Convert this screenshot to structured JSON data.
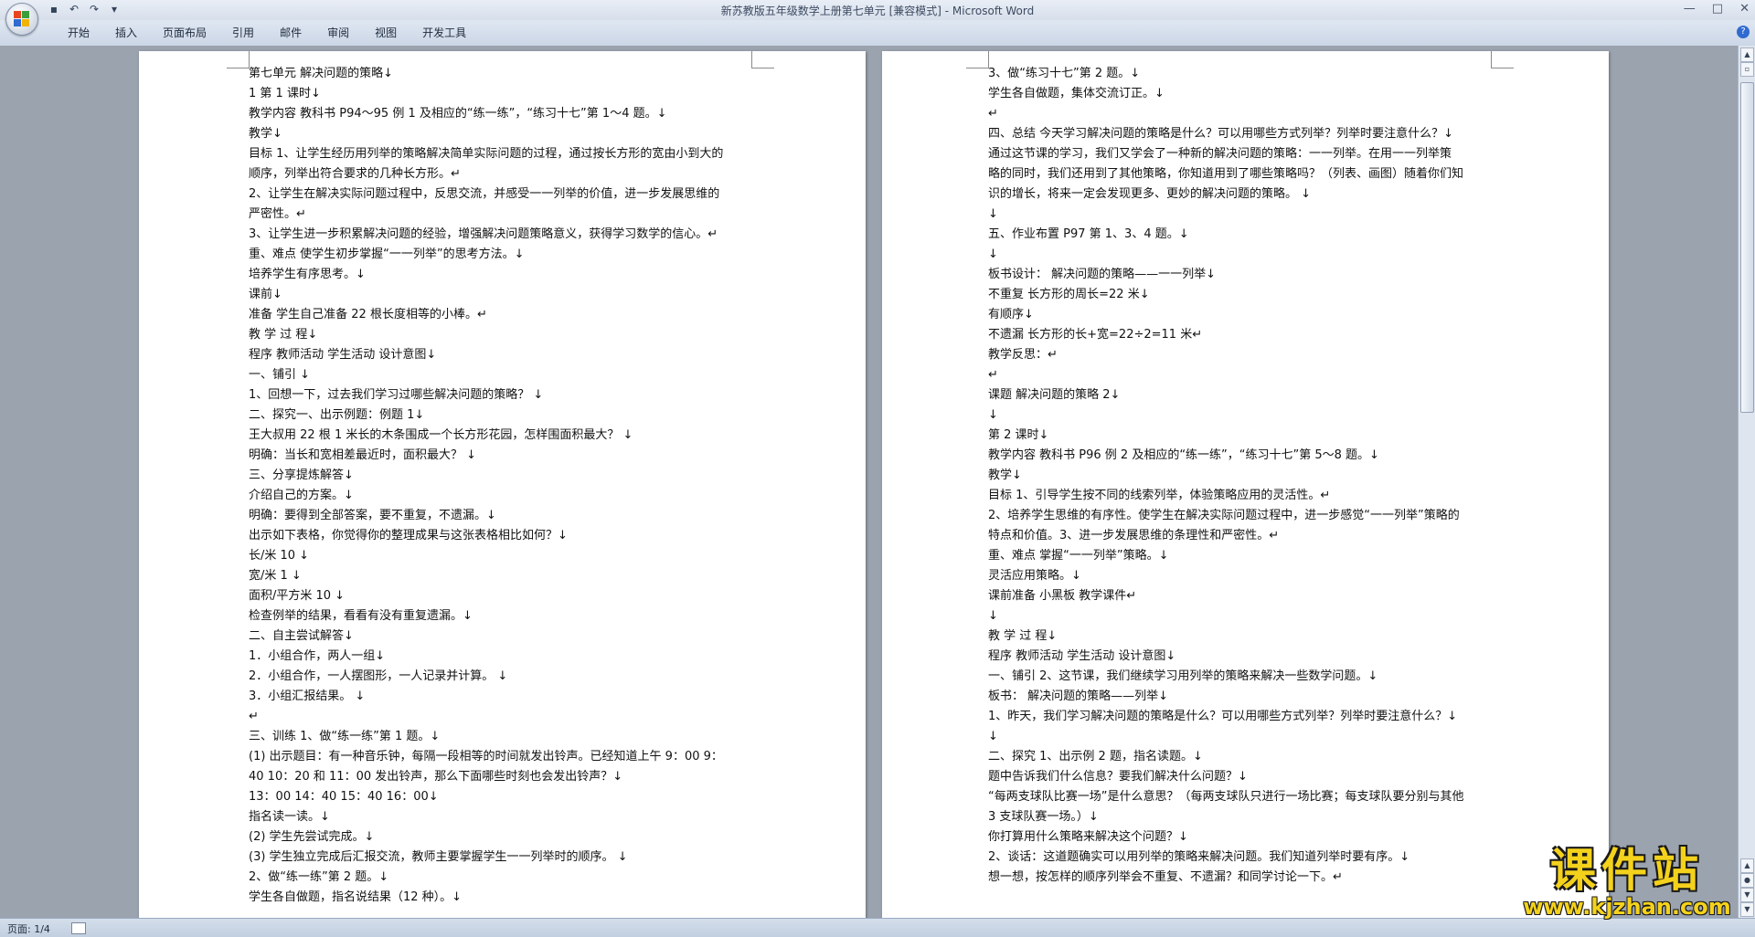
{
  "window": {
    "title": "新苏教版五年级数学上册第七单元 [兼容模式] - Microsoft Word",
    "controls": [
      "—",
      "□",
      "✕"
    ]
  },
  "ribbon": {
    "tabs": [
      "开始",
      "插入",
      "页面布局",
      "引用",
      "邮件",
      "审阅",
      "视图",
      "开发工具"
    ],
    "help": "?"
  },
  "document": {
    "left_page": [
      " 第七单元    解决问题的策略↓",
      " 1 第 1 课时↓",
      " 教学内容 教科书 P94～95 例 1 及相应的“练一练”，“练习十七”第 1～4 题。↓",
      " 教学↓",
      " 目标 1、让学生经历用列举的策略解决简单实际问题的过程，通过按长方形的宽由小到大的",
      " 顺序，列举出符合要求的几种长方形。↵",
      "  2、让学生在解决实际问题过程中，反思交流，并感受一一列举的价值，进一步发展思维的",
      " 严密性。↵",
      " 3、让学生进一步积累解决问题的经验，增强解决问题策略意义，获得学习数学的信心。↵",
      " 重、难点 使学生初步掌握“一一列举”的思考方法。↓",
      "  培养学生有序思考。↓",
      " 课前↓",
      " 准备 学生自己准备 22 根长度相等的小棒。↵",
      "  教           学           过           程↓",
      " 程序 教师活动 学生活动 设计意图↓",
      " 一、铺引 ↓",
      "  1、回想一下，过去我们学习过哪些解决问题的策略？ ↓",
      " 二、探究一、出示例题：例题 1↓",
      " 王大叔用 22 根 1 米长的木条围成一个长方形花园，怎样围面积最大？ ↓",
      " 明确：当长和宽相差最近时，面积最大？ ↓",
      " 三、分享提炼解答↓",
      " 介绍自己的方案。↓",
      " 明确：要得到全部答案，要不重复，不遗漏。↓",
      "  出示如下表格，你觉得你的整理成果与这张表格相比如何？↓",
      " 长/米 10    ↓",
      " 宽/米 1    ↓",
      " 面积/平方米 10    ↓",
      " 检查例举的结果，看看有没有重复遗漏。↓",
      " 二、自主尝试解答↓",
      " 1．小组合作，两人一组↓",
      " 2．小组合作，一人摆图形，一人记录并计算。 ↓",
      " 3．小组汇报结果。 ↓",
      " ↵",
      " 三、训练 1、做“练一练”第 1 题。↓",
      "  (1) 出示题目：有一种音乐钟，每隔一段相等的时间就发出铃声。已经知道上午 9：00   9：",
      " 40   10：20 和 11：00 发出铃声，那么下面哪些时刻也会发出铃声？↓",
      " 13：00     14：40     15：40     16：00↓",
      "  指名读一读。↓",
      "  (2) 学生先尝试完成。↓",
      "  (3) 学生独立完成后汇报交流，教师主要掌握学生一一列举时的顺序。 ↓",
      " 2、做“练一练”第 2 题。↓",
      " 学生各自做题，指名说结果（12 种）。↓"
    ],
    "right_page": [
      " 3、做“练习十七”第 2 题。↓",
      " 学生各自做题，集体交流订正。↓",
      " ↵",
      " 四、总结 今天学习解决问题的策略是什么？可以用哪些方式列举？列举时要注意什么？↓",
      "  通过这节课的学习，我们又学会了一种新的解决问题的策略：一一列举。在用一一列举策",
      " 略的同时，我们还用到了其他策略，你知道用到了哪些策略吗？（列表、画图）随着你们知",
      " 识的增长，将来一定会发现更多、更妙的解决问题的策略。 ↓",
      "  ↓",
      " 五、作业布置  P97 第 1、3、4 题。↓",
      "  ↓",
      " 板书设计：              解决问题的策略——一一列举↓",
      " 不重复      长方形的周长=22 米↓",
      " 有顺序↓",
      " 不遗漏      长方形的长+宽=22÷2=11 米↵",
      " 教学反思：↵",
      " ↵",
      " 课题 解决问题的策略 2↓",
      "  ↓",
      " 第 2 课时↓",
      " 教学内容 教科书 P96 例 2 及相应的“练一练”，“练习十七”第 5～8 题。↓",
      " 教学↓",
      " 目标 1、引导学生按不同的线索列举，体验策略应用的灵活性。↵",
      "  2、培养学生思维的有序性。使学生在解决实际问题过程中，进一步感觉“一一列举”策略的",
      " 特点和价值。3、进一步发展思维的条理性和严密性。↵",
      " 重、难点 掌握“一一列举”策略。↓",
      "  灵活应用策略。↓",
      " 课前准备 小黑板   教学课件↵",
      "  ↓",
      "  教          学          过          程↓",
      " 程序 教师活动 学生活动 设计意图↓",
      " 一、铺引   2、这节课，我们继续学习用列举的策略来解决一些数学问题。↓",
      "    板书：  解决问题的策略——列举↓",
      "  1、昨天，我们学习解决问题的策略是什么？可以用哪些方式列举？列举时要注意什么？↓",
      "  ↓",
      " 二、探究 1、出示例 2 题，指名读题。↓",
      " 题中告诉我们什么信息？要我们解决什么问题？↓",
      " “每两支球队比赛一场”是什么意思？（每两支球队只进行一场比赛；每支球队要分别与其他",
      " 3 支球队赛一场。）↓",
      " 你打算用什么策略来解决这个问题？↓",
      " 2、谈话：这道题确实可以用列举的策略来解决问题。我们知道列举时要有序。↓",
      "  想一想，按怎样的顺序列举会不重复、不遗漏？和同学讨论一下。↵"
    ]
  },
  "statusbar": {
    "page": "页面: 1/4"
  },
  "watermark": {
    "text": "课件站",
    "url": "www.kjzhan.com"
  },
  "colors": {
    "office_logo": [
      "#e8451f",
      "#3a9f3a",
      "#2f6bd0",
      "#f0b400"
    ],
    "watermark": "#f4d21c"
  }
}
